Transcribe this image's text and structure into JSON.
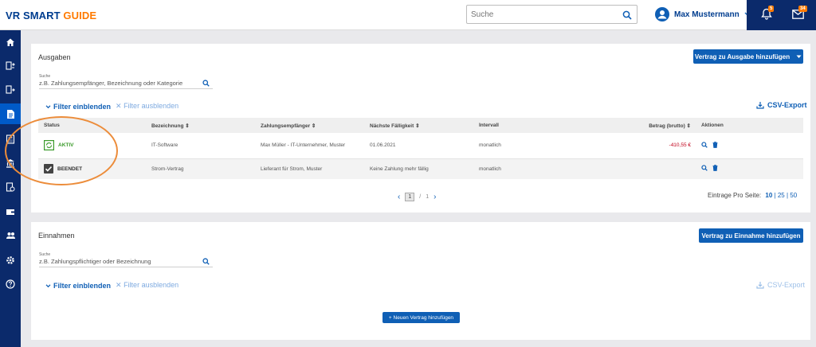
{
  "header": {
    "logo_part1": "VR SMART",
    "logo_part2": "GUIDE",
    "search_placeholder": "Suche",
    "user_name": "Max Mustermann",
    "notifications_count": "5",
    "messages_count": "34"
  },
  "sidebar": {
    "items": [
      "home-icon",
      "transfer-in-icon",
      "transfer-out-icon",
      "document-icon",
      "calculator-icon",
      "bank-icon",
      "document-check-icon",
      "wallet-icon",
      "people-icon",
      "gear-icon",
      "help-icon"
    ],
    "active_index": 3
  },
  "ausgaben": {
    "title": "Ausgaben",
    "add_button": "Vertrag zu Ausgabe hinzufügen",
    "search_label": "Suche",
    "search_placeholder": "z.B. Zahlungsempfänger, Bezeichnung oder Kategorie",
    "filter_show": "Filter einblenden",
    "filter_hide": "Filter ausblenden",
    "csv_export": "CSV-Export",
    "columns": [
      "Status",
      "Bezeichnung",
      "Zahlungsempfänger",
      "Nächste Fälligkeit",
      "Intervall",
      "Betrag (brutto)",
      "Aktionen"
    ],
    "rows": [
      {
        "status": "AKTIV",
        "status_color": "#3a9a2a",
        "bezeichnung": "IT-Software",
        "empfaenger": "Max Müller - IT-Unternehmer, Muster",
        "faelligkeit": "01.06.2021",
        "intervall": "monatlich",
        "betrag": "-410,55 €"
      },
      {
        "status": "BEENDET",
        "status_color": "#333333",
        "bezeichnung": "Strom-Vertrag",
        "empfaenger": "Lieferant für Strom, Muster",
        "faelligkeit": "Keine Zahlung mehr fällig",
        "intervall": "monatlich",
        "betrag": ""
      }
    ],
    "pagination": {
      "current": "1",
      "separator": "/",
      "total": "1"
    },
    "per_page_label": "Eintrage Pro Seite:",
    "per_page_options": [
      "10",
      "25",
      "50"
    ]
  },
  "einnahmen": {
    "title": "Einnahmen",
    "add_button": "Vertrag zu Einnahme hinzufügen",
    "search_label": "Suche",
    "search_placeholder": "z.B. Zahlungspflichtiger oder Bezeichnung",
    "filter_show": "Filter einblenden",
    "filter_hide": "Filter ausblenden",
    "csv_export": "CSV-Export",
    "new_contract_button": "+ Neuen Vertrag hinzufügen"
  },
  "colors": {
    "brand_blue": "#003d8f",
    "brand_orange": "#ff7a00",
    "button_blue": "#0f5fb5",
    "sidebar_bg": "#0b2a6b",
    "negative_amount": "#c0001a",
    "annotation_orange": "#ec8c3a"
  }
}
